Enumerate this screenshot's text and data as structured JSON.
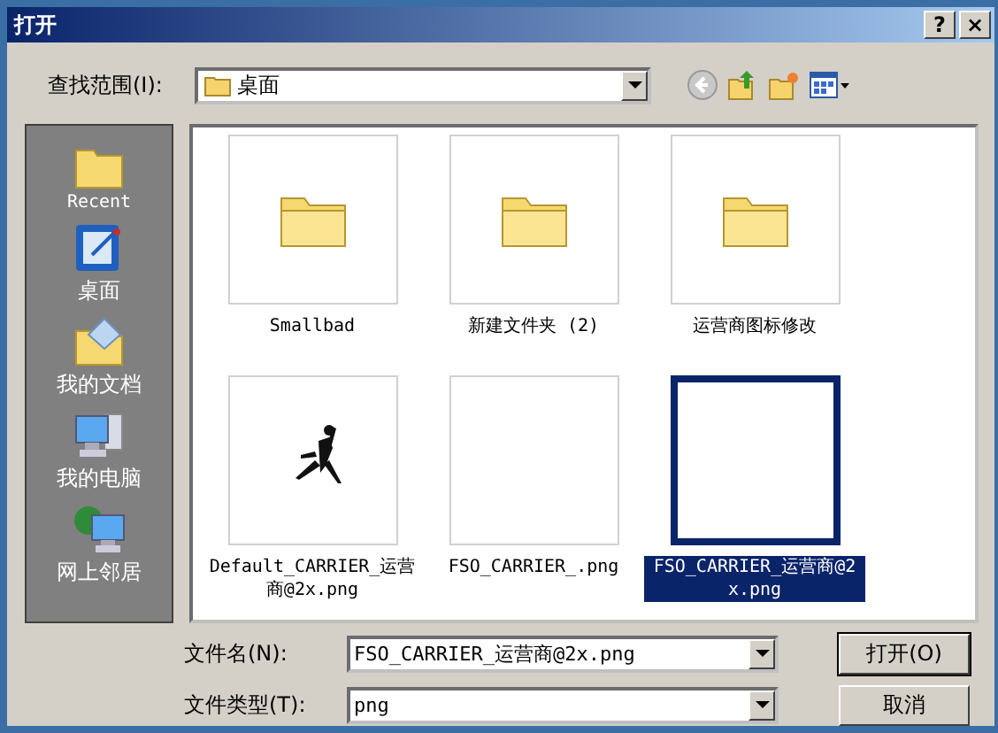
{
  "window": {
    "title": "打开",
    "help_button": "?",
    "close_button": "×"
  },
  "look_in": {
    "label": "查找范围(I):",
    "value": "桌面"
  },
  "places": [
    {
      "label": "Recent",
      "kind": "recent"
    },
    {
      "label": "桌面",
      "kind": "desktop"
    },
    {
      "label": "我的文档",
      "kind": "documents"
    },
    {
      "label": "我的电脑",
      "kind": "computer"
    },
    {
      "label": "网上邻居",
      "kind": "network"
    }
  ],
  "files": [
    {
      "name": "Smallbad",
      "kind": "folder",
      "selected": false
    },
    {
      "name": "新建文件夹 (2)",
      "kind": "folder",
      "selected": false
    },
    {
      "name": "运营商图标修改",
      "kind": "folder",
      "selected": false
    },
    {
      "name": "Default_CARRIER_运营商@2x.png",
      "kind": "picture",
      "selected": false
    },
    {
      "name": "FSO_CARRIER_.png",
      "kind": "blank",
      "selected": false
    },
    {
      "name": "FSO_CARRIER_运营商@2x.png",
      "kind": "blank",
      "selected": true
    }
  ],
  "file_name": {
    "label": "文件名(N):",
    "value": "FSO_CARRIER_运营商@2x.png"
  },
  "file_type": {
    "label": "文件类型(T):",
    "value": "png"
  },
  "buttons": [
    "打开(O)",
    "取消"
  ]
}
